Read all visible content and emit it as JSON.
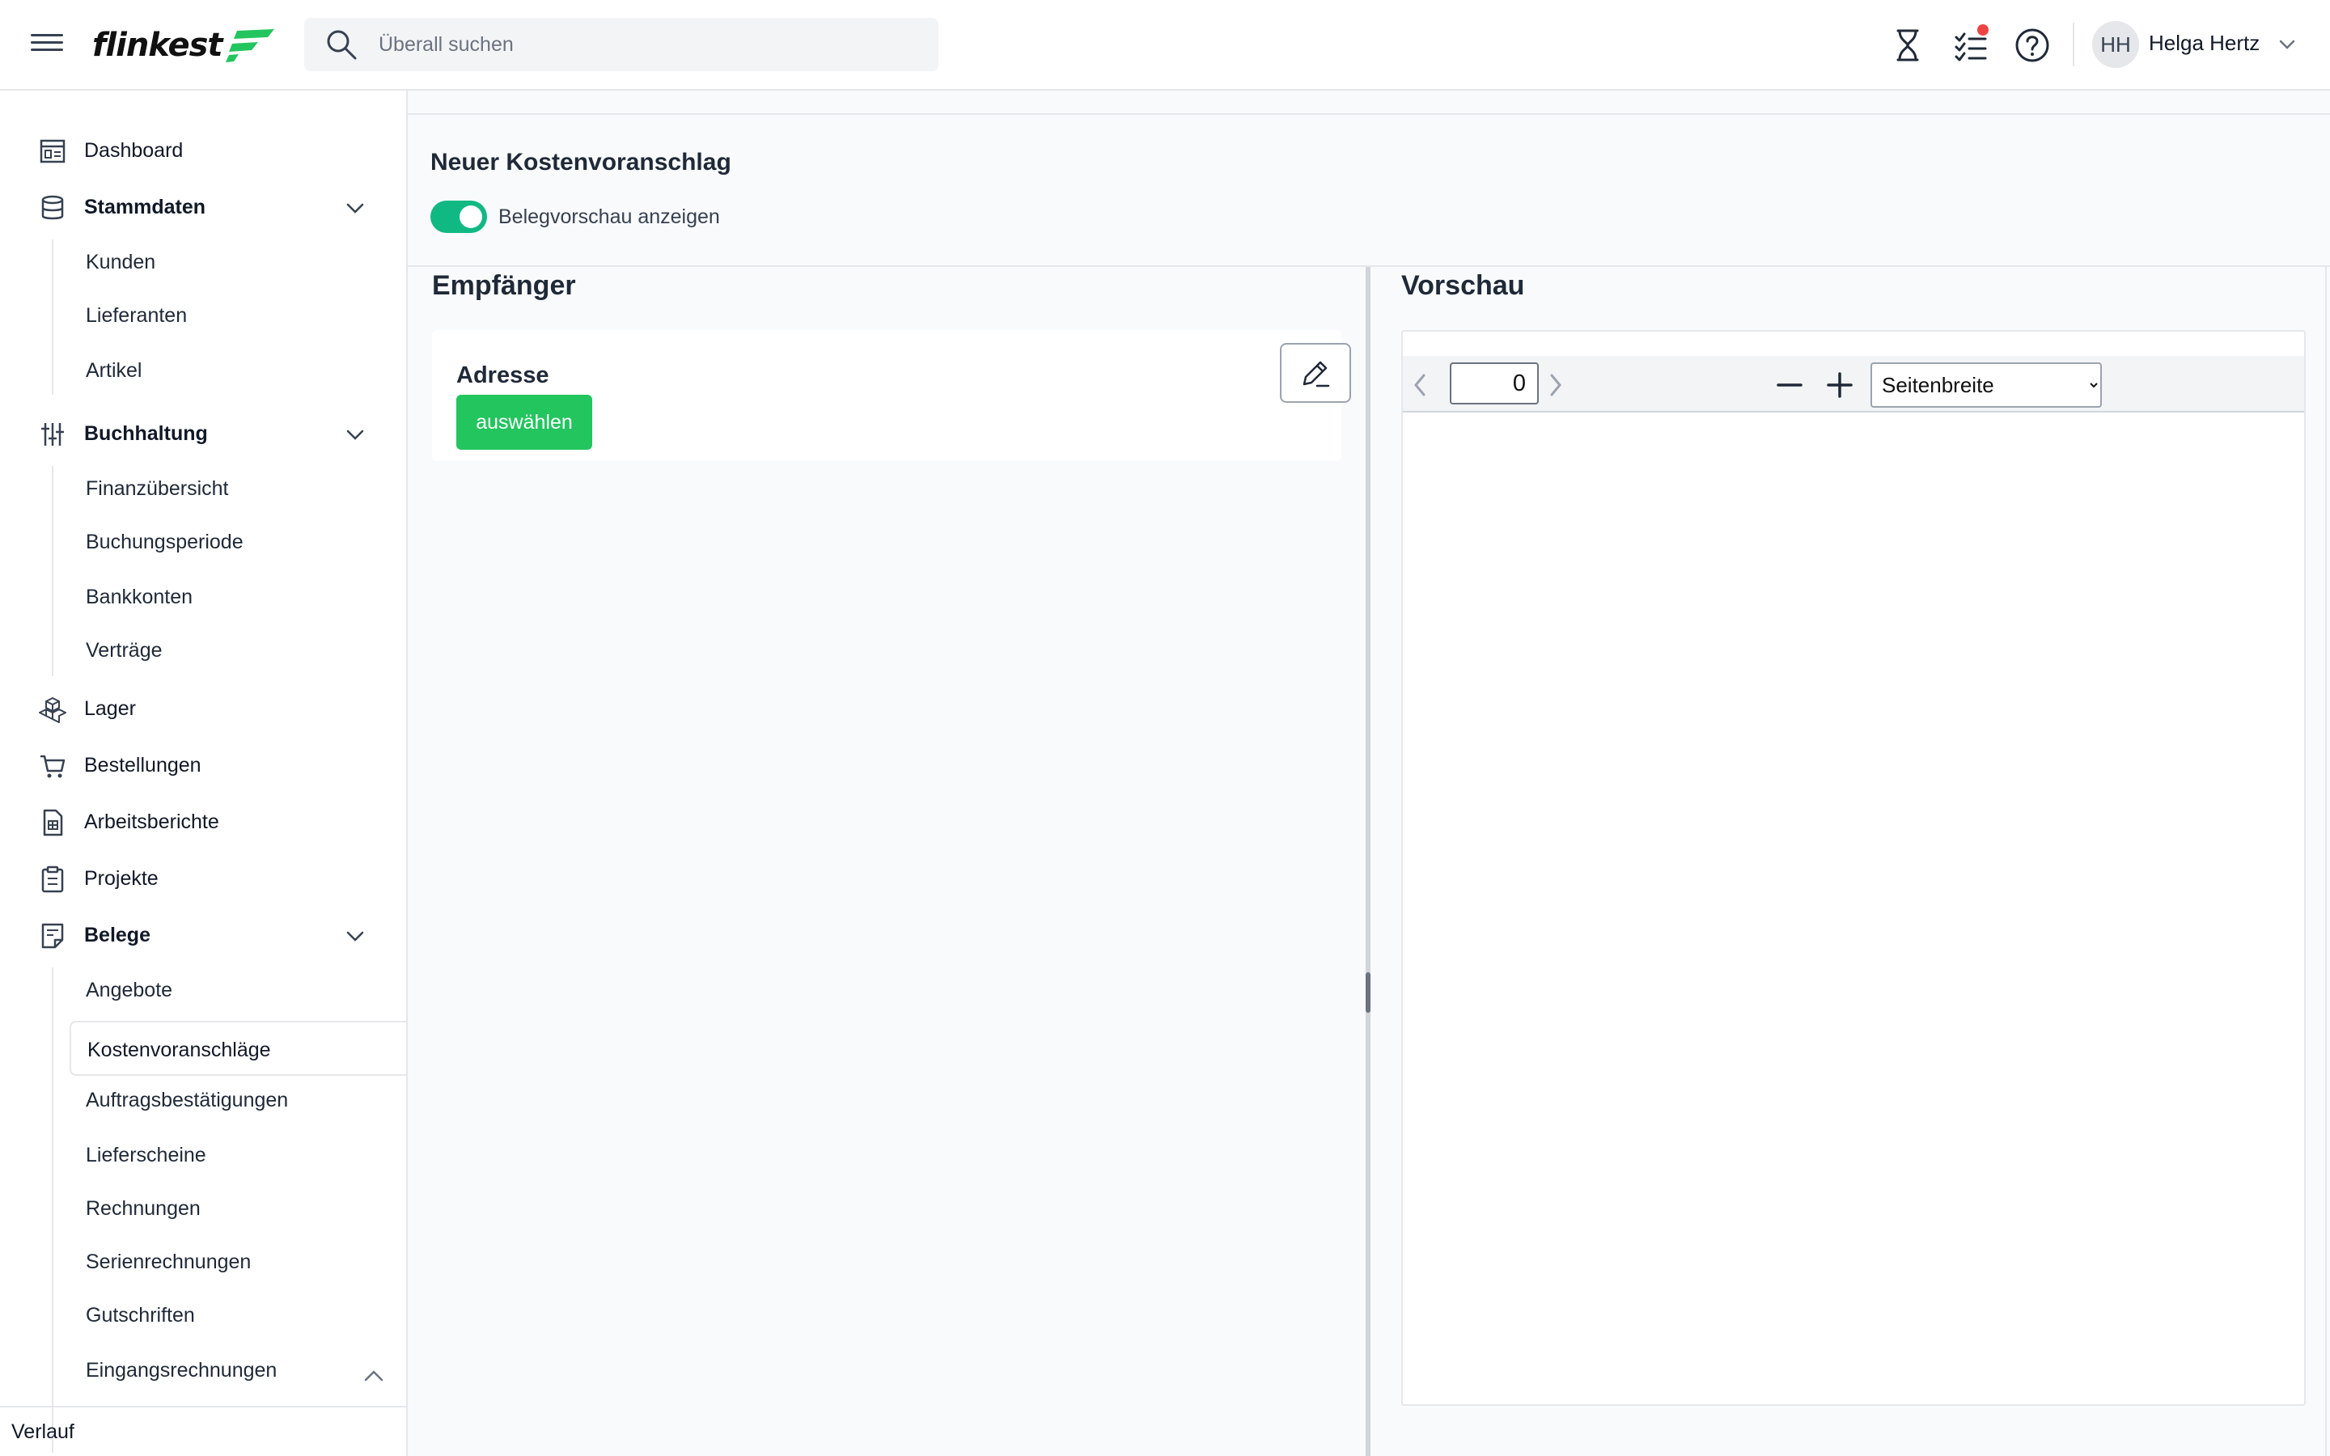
{
  "header": {
    "logo_text": "flinkest",
    "search_placeholder": "Überall suchen",
    "user_initials": "HH",
    "user_name": "Helga Hertz"
  },
  "sidebar": {
    "dashboard": "Dashboard",
    "stammdaten": "Stammdaten",
    "kunden": "Kunden",
    "lieferanten": "Lieferanten",
    "artikel": "Artikel",
    "buchhaltung": "Buchhaltung",
    "finanzuebersicht": "Finanzübersicht",
    "buchungsperiode": "Buchungsperiode",
    "bankkonten": "Bankkonten",
    "vertraege": "Verträge",
    "lager": "Lager",
    "bestellungen": "Bestellungen",
    "arbeitsberichte": "Arbeitsberichte",
    "projekte": "Projekte",
    "belege": "Belege",
    "angebote": "Angebote",
    "kostenvoranschlaege": "Kostenvoranschläge",
    "auftragsbestaetigungen": "Auftragsbestätigungen",
    "lieferscheine": "Lieferscheine",
    "rechnungen": "Rechnungen",
    "serienrechnungen": "Serienrechnungen",
    "gutschriften": "Gutschriften",
    "eingangsrechnungen": "Eingangsrechnungen",
    "verlauf": "Verlauf"
  },
  "main": {
    "page_title": "Neuer Kostenvoranschlag",
    "toggle_label": "Belegvorschau anzeigen",
    "recipient_title": "Empfänger",
    "address_label": "Adresse",
    "select_button": "auswählen",
    "preview_title": "Vorschau",
    "page_number": "0",
    "scale_option": "Seitenbreite"
  },
  "colors": {
    "accent_green": "#22c55e",
    "toggle_green": "#10b981",
    "notification_red": "#ef4444"
  }
}
